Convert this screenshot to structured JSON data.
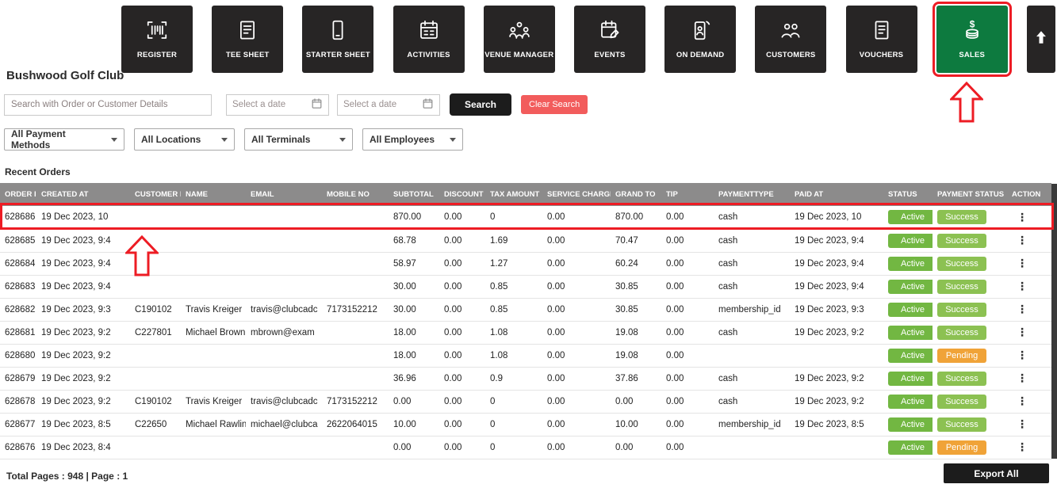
{
  "brand": {
    "club_name": "Bushwood Golf Club"
  },
  "toolbar": {
    "items": [
      {
        "label": "REGISTER"
      },
      {
        "label": "TEE SHEET"
      },
      {
        "label": "STARTER SHEET"
      },
      {
        "label": "ACTIVITIES"
      },
      {
        "label": "VENUE MANAGER"
      },
      {
        "label": "EVENTS"
      },
      {
        "label": "ON DEMAND"
      },
      {
        "label": "CUSTOMERS"
      },
      {
        "label": "VOUCHERS"
      },
      {
        "label": "SALES",
        "active": true
      }
    ]
  },
  "search": {
    "order_search_placeholder": "Search with Order or Customer Details",
    "date_from_placeholder": "Select a date",
    "date_to_placeholder": "Select a date",
    "search_button": "Search",
    "clear_button": "Clear Search"
  },
  "filters": {
    "payment_methods": "All Payment Methods",
    "locations": "All Locations",
    "terminals": "All Terminals",
    "employees": "All Employees"
  },
  "section_title": "Recent Orders",
  "table": {
    "action_icon": "⋮",
    "columns": [
      "ORDER ID",
      "CREATED AT",
      "CUSTOMER ID",
      "NAME",
      "EMAIL",
      "MOBILE NO",
      "SUBTOTAL",
      "DISCOUNT",
      "TAX AMOUNT",
      "SERVICE CHARGE",
      "GRAND TO",
      "TIP",
      "PAYMENTTYPE",
      "PAID AT",
      "STATUS",
      "PAYMENT STATUS",
      "ACTION"
    ],
    "rows": [
      {
        "order_id": "628686",
        "created_at": "19 Dec 2023, 10",
        "customer_id": "",
        "name": "",
        "email": "",
        "mobile_no": "",
        "subtotal": "870.00",
        "discount": "0.00",
        "tax_amount": "0",
        "service_charge": "0.00",
        "grand_total": "870.00",
        "tip": "0.00",
        "payment_type": "cash",
        "paid_at": "19 Dec 2023, 10",
        "status": "Active",
        "payment_status": "Success"
      },
      {
        "order_id": "628685",
        "created_at": "19 Dec 2023, 9:4",
        "customer_id": "",
        "name": "",
        "email": "",
        "mobile_no": "",
        "subtotal": "68.78",
        "discount": "0.00",
        "tax_amount": "1.69",
        "service_charge": "0.00",
        "grand_total": "70.47",
        "tip": "0.00",
        "payment_type": "cash",
        "paid_at": "19 Dec 2023, 9:4",
        "status": "Active",
        "payment_status": "Success"
      },
      {
        "order_id": "628684",
        "created_at": "19 Dec 2023, 9:4",
        "customer_id": "",
        "name": "",
        "email": "",
        "mobile_no": "",
        "subtotal": "58.97",
        "discount": "0.00",
        "tax_amount": "1.27",
        "service_charge": "0.00",
        "grand_total": "60.24",
        "tip": "0.00",
        "payment_type": "cash",
        "paid_at": "19 Dec 2023, 9:4",
        "status": "Active",
        "payment_status": "Success"
      },
      {
        "order_id": "628683",
        "created_at": "19 Dec 2023, 9:4",
        "customer_id": "",
        "name": "",
        "email": "",
        "mobile_no": "",
        "subtotal": "30.00",
        "discount": "0.00",
        "tax_amount": "0.85",
        "service_charge": "0.00",
        "grand_total": "30.85",
        "tip": "0.00",
        "payment_type": "cash",
        "paid_at": "19 Dec 2023, 9:4",
        "status": "Active",
        "payment_status": "Success"
      },
      {
        "order_id": "628682",
        "created_at": "19 Dec 2023, 9:3",
        "customer_id": "C190102",
        "name": "Travis Kreiger",
        "email": "travis@clubcadc",
        "mobile_no": "7173152212",
        "subtotal": "30.00",
        "discount": "0.00",
        "tax_amount": "0.85",
        "service_charge": "0.00",
        "grand_total": "30.85",
        "tip": "0.00",
        "payment_type": "membership_id",
        "paid_at": "19 Dec 2023, 9:3",
        "status": "Active",
        "payment_status": "Success"
      },
      {
        "order_id": "628681",
        "created_at": "19 Dec 2023, 9:2",
        "customer_id": "C227801",
        "name": "Michael Brown",
        "email": "mbrown@exam",
        "mobile_no": "",
        "subtotal": "18.00",
        "discount": "0.00",
        "tax_amount": "1.08",
        "service_charge": "0.00",
        "grand_total": "19.08",
        "tip": "0.00",
        "payment_type": "cash",
        "paid_at": "19 Dec 2023, 9:2",
        "status": "Active",
        "payment_status": "Success"
      },
      {
        "order_id": "628680",
        "created_at": "19 Dec 2023, 9:2",
        "customer_id": "",
        "name": "",
        "email": "",
        "mobile_no": "",
        "subtotal": "18.00",
        "discount": "0.00",
        "tax_amount": "1.08",
        "service_charge": "0.00",
        "grand_total": "19.08",
        "tip": "0.00",
        "payment_type": "",
        "paid_at": "",
        "status": "Active",
        "payment_status": "Pending"
      },
      {
        "order_id": "628679",
        "created_at": "19 Dec 2023, 9:2",
        "customer_id": "",
        "name": "",
        "email": "",
        "mobile_no": "",
        "subtotal": "36.96",
        "discount": "0.00",
        "tax_amount": "0.9",
        "service_charge": "0.00",
        "grand_total": "37.86",
        "tip": "0.00",
        "payment_type": "cash",
        "paid_at": "19 Dec 2023, 9:2",
        "status": "Active",
        "payment_status": "Success"
      },
      {
        "order_id": "628678",
        "created_at": "19 Dec 2023, 9:2",
        "customer_id": "C190102",
        "name": "Travis Kreiger",
        "email": "travis@clubcadc",
        "mobile_no": "7173152212",
        "subtotal": "0.00",
        "discount": "0.00",
        "tax_amount": "0",
        "service_charge": "0.00",
        "grand_total": "0.00",
        "tip": "0.00",
        "payment_type": "cash",
        "paid_at": "19 Dec 2023, 9:2",
        "status": "Active",
        "payment_status": "Success"
      },
      {
        "order_id": "628677",
        "created_at": "19 Dec 2023, 8:5",
        "customer_id": "C22650",
        "name": "Michael Rawlins",
        "email": "michael@clubca",
        "mobile_no": "2622064015",
        "subtotal": "10.00",
        "discount": "0.00",
        "tax_amount": "0",
        "service_charge": "0.00",
        "grand_total": "10.00",
        "tip": "0.00",
        "payment_type": "membership_id",
        "paid_at": "19 Dec 2023, 8:5",
        "status": "Active",
        "payment_status": "Success"
      },
      {
        "order_id": "628676",
        "created_at": "19 Dec 2023, 8:4",
        "customer_id": "",
        "name": "",
        "email": "",
        "mobile_no": "",
        "subtotal": "0.00",
        "discount": "0.00",
        "tax_amount": "0",
        "service_charge": "0.00",
        "grand_total": "0.00",
        "tip": "0.00",
        "payment_type": "",
        "paid_at": "",
        "status": "Active",
        "payment_status": "Pending"
      }
    ]
  },
  "footer": {
    "pagination": "Total Pages : 948 | Page : 1",
    "export_button": "Export All"
  },
  "colors": {
    "accent_green": "#0d7a3f",
    "annotation_red": "#ed1c24",
    "badge_active": "#72b742",
    "badge_success": "#8cc152",
    "badge_pending": "#f0a338",
    "button_dark": "#272525",
    "clear_red": "#f25c5c"
  }
}
